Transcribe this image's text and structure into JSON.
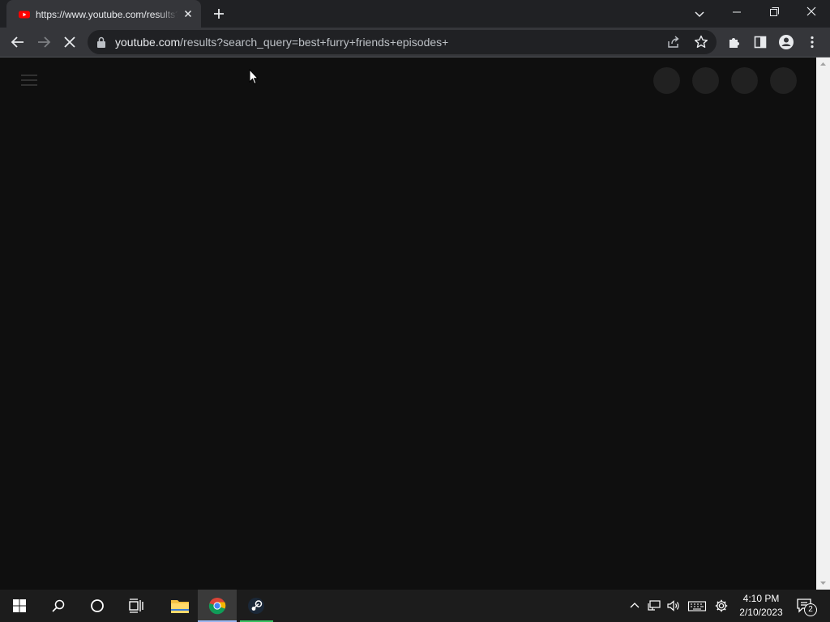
{
  "browser": {
    "tab": {
      "title": "https://www.youtube.com/results?search_query=best+furry+friends+episodes+",
      "favicon": "youtube-favicon"
    },
    "omnibox": {
      "url_host": "youtube.com",
      "url_path": "/results?search_query=best+furry+friends+episodes+"
    },
    "theme": {
      "tab_strip": "#202124",
      "toolbar": "#35363a",
      "omnibox": "#202124"
    }
  },
  "page": {
    "background": "#0f0f0f",
    "skeleton_color": "#212121",
    "state": "loading"
  },
  "taskbar": {
    "clock_time": "4:10 PM",
    "clock_date": "2/10/2023",
    "notification_count": "2",
    "apps": [
      "start-icon",
      "search-icon",
      "cortana-icon",
      "task-view-icon",
      "file-explorer-icon",
      "chrome-icon",
      "steam-icon"
    ]
  }
}
